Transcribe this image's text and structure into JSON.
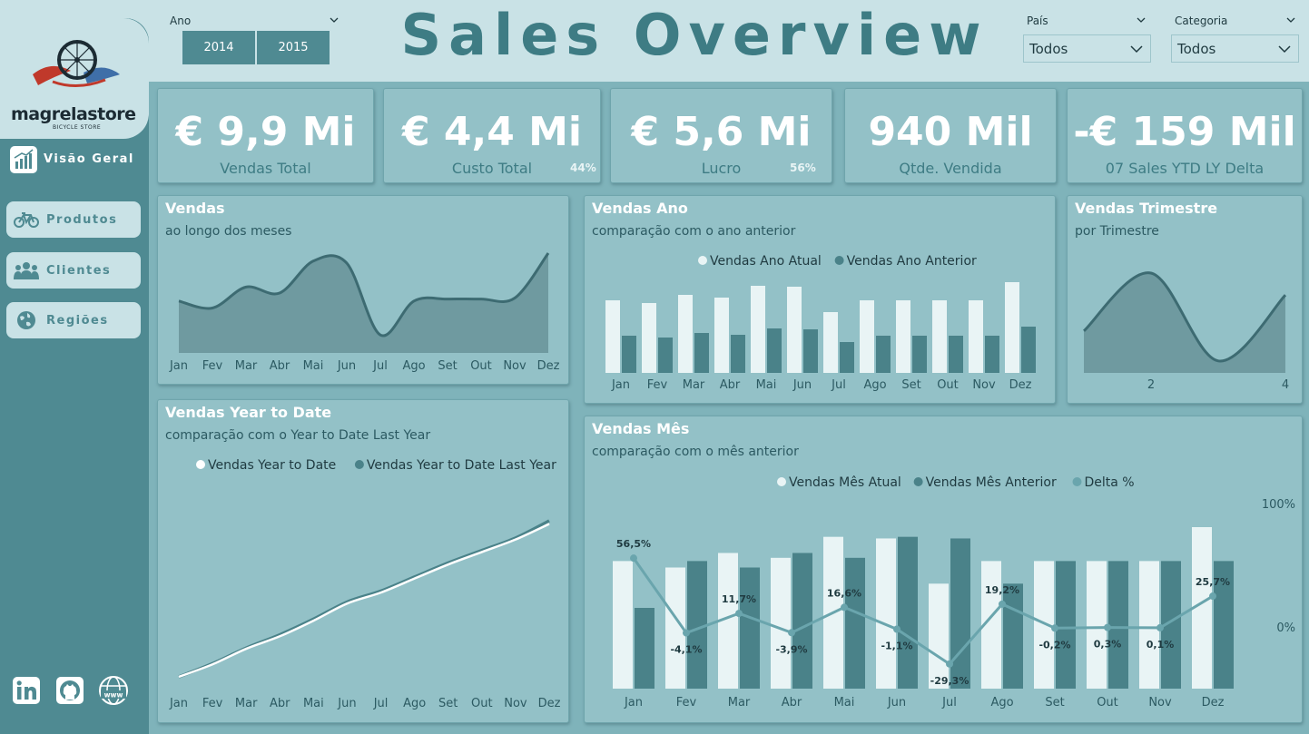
{
  "header": {
    "title": "Sales Overview",
    "year_label": "Ano",
    "years": [
      "2014",
      "2015"
    ],
    "country_label": "País",
    "country_value": "Todos",
    "category_label": "Categoria",
    "category_value": "Todos"
  },
  "sidebar": {
    "logo_name": "magrelastore",
    "logo_tagline": "BICYCLE STORE",
    "items": [
      {
        "label": "Visão Geral",
        "icon": "chart-icon",
        "active": true
      },
      {
        "label": "Produtos",
        "icon": "bicycle-icon"
      },
      {
        "label": "Clientes",
        "icon": "users-icon"
      },
      {
        "label": "Regiões",
        "icon": "globe-icon"
      }
    ],
    "social": [
      "linkedin-icon",
      "github-icon",
      "www-globe-icon"
    ]
  },
  "kpis": [
    {
      "value": "€ 9,9 Mi",
      "label": "Vendas Total"
    },
    {
      "value": "€ 4,4 Mi",
      "label": "Custo Total",
      "pct": "44%"
    },
    {
      "value": "€ 5,6 Mi",
      "label": "Lucro",
      "pct": "56%"
    },
    {
      "value": "940 Mil",
      "label": "Qtde. Vendida"
    },
    {
      "value": "-€ 159 Mil",
      "label": "07 Sales YTD LY Delta"
    }
  ],
  "colors": {
    "accent": "#4f8a92",
    "card": "#93c1c7",
    "light_bar": "#e9f4f5",
    "dark_bar": "#4a8289",
    "line": "#3d6b72",
    "delta": "#6aa5ad"
  },
  "chart_data": [
    {
      "id": "vendas",
      "type": "area",
      "title": "Vendas",
      "subtitle": "ao longo dos meses",
      "categories": [
        "Jan",
        "Fev",
        "Mar",
        "Abr",
        "Mai",
        "Jun",
        "Jul",
        "Ago",
        "Set",
        "Out",
        "Nov",
        "Dez"
      ],
      "series": [
        {
          "values": [
            0.52,
            0.45,
            0.66,
            0.6,
            0.92,
            0.9,
            0.18,
            0.52,
            0.54,
            0.54,
            0.55,
            1.0
          ]
        }
      ]
    },
    {
      "id": "vendas_ano",
      "type": "bar",
      "title": "Vendas Ano",
      "subtitle": "comparação com o ano anterior",
      "categories": [
        "Jan",
        "Fev",
        "Mar",
        "Abr",
        "Mai",
        "Jun",
        "Jul",
        "Ago",
        "Set",
        "Out",
        "Nov",
        "Dez"
      ],
      "series": [
        {
          "name": "Vendas Ano Atual",
          "values": [
            0.8,
            0.77,
            0.86,
            0.83,
            0.96,
            0.95,
            0.67,
            0.8,
            0.8,
            0.8,
            0.8,
            1.0
          ]
        },
        {
          "name": "Vendas Ano Anterior",
          "values": [
            0.41,
            0.39,
            0.44,
            0.42,
            0.49,
            0.48,
            0.34,
            0.41,
            0.41,
            0.41,
            0.41,
            0.51
          ]
        }
      ]
    },
    {
      "id": "vendas_trimestre",
      "type": "area",
      "title": "Vendas Trimestre",
      "subtitle": "por Trimestre",
      "categories": [
        "1",
        "2",
        "3",
        "4"
      ],
      "tick_labels": [
        "2",
        "4"
      ],
      "series": [
        {
          "values": [
            0.42,
            1.0,
            0.12,
            0.78
          ]
        }
      ]
    },
    {
      "id": "vendas_ytd",
      "type": "line",
      "title": "Vendas Year to Date",
      "subtitle": "comparação com o Year to Date Last Year",
      "categories": [
        "Jan",
        "Fev",
        "Mar",
        "Abr",
        "Mai",
        "Jun",
        "Jul",
        "Ago",
        "Set",
        "Out",
        "Nov",
        "Dez"
      ],
      "series": [
        {
          "name": "Vendas Year to Date",
          "values": [
            0.0,
            0.08,
            0.18,
            0.26,
            0.36,
            0.47,
            0.54,
            0.63,
            0.72,
            0.8,
            0.88,
            0.98
          ]
        },
        {
          "name": "Vendas Year to Date Last Year",
          "values": [
            0.0,
            0.085,
            0.185,
            0.27,
            0.37,
            0.48,
            0.55,
            0.64,
            0.73,
            0.81,
            0.89,
            1.0
          ]
        }
      ]
    },
    {
      "id": "vendas_mes",
      "type": "bar",
      "title": "Vendas Mês",
      "subtitle": "comparação com o mês anterior",
      "categories": [
        "Jan",
        "Fev",
        "Mar",
        "Abr",
        "Mai",
        "Jun",
        "Jul",
        "Ago",
        "Set",
        "Out",
        "Nov",
        "Dez"
      ],
      "y2_ticks": [
        "100%",
        "0%"
      ],
      "series": [
        {
          "name": "Vendas Mês Atual",
          "values": [
            0.79,
            0.75,
            0.84,
            0.81,
            0.94,
            0.93,
            0.65,
            0.79,
            0.79,
            0.79,
            0.79,
            1.0
          ]
        },
        {
          "name": "Vendas Mês Anterior",
          "values": [
            0.5,
            0.79,
            0.75,
            0.84,
            0.81,
            0.94,
            0.93,
            0.65,
            0.79,
            0.79,
            0.79,
            0.79
          ]
        },
        {
          "name": "Delta %",
          "values": [
            56.5,
            -4.1,
            11.7,
            -3.9,
            16.6,
            -1.1,
            -29.3,
            19.2,
            -0.2,
            0.3,
            0.1,
            25.7
          ],
          "labels": [
            "56,5%",
            "-4,1%",
            "11,7%",
            "-3,9%",
            "16,6%",
            "-1,1%",
            "-29,3%",
            "19,2%",
            "-0,2%",
            "0,3%",
            "0,1%",
            "25,7%"
          ]
        }
      ]
    }
  ]
}
